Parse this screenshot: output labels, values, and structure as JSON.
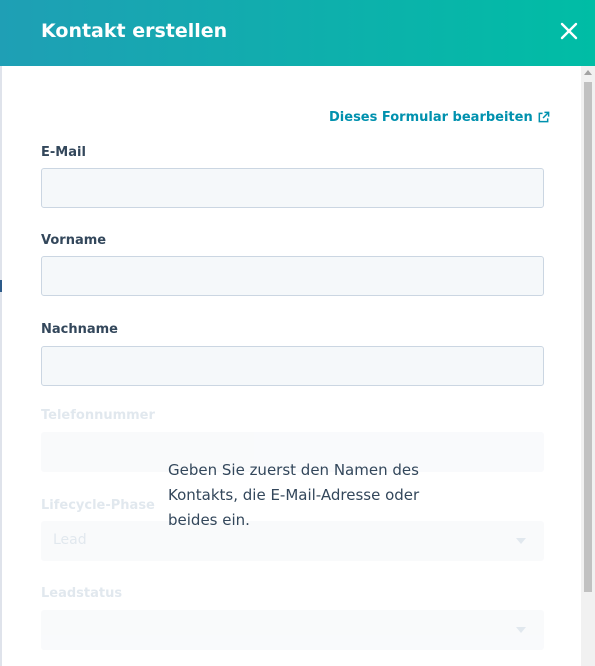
{
  "header": {
    "title": "Kontakt erstellen",
    "close_icon": "close-icon"
  },
  "form": {
    "edit_link": "Dieses Formular bearbeiten",
    "fields": [
      {
        "label": "E-Mail",
        "value": ""
      },
      {
        "label": "Vorname",
        "value": ""
      },
      {
        "label": "Nachname",
        "value": ""
      }
    ],
    "disabled_fields": [
      {
        "label": "Telefonnummer",
        "value": ""
      },
      {
        "label": "Lifecycle-Phase",
        "value": "Lead"
      },
      {
        "label": "Leadstatus",
        "value": ""
      }
    ],
    "hint": "Geben Sie zuerst den Namen des Kontakts, die E-Mail-Adresse oder beides ein."
  },
  "colors": {
    "header_start": "#1f9fb5",
    "header_end": "#00bda5",
    "link": "#0091ae",
    "text": "#33475b"
  }
}
